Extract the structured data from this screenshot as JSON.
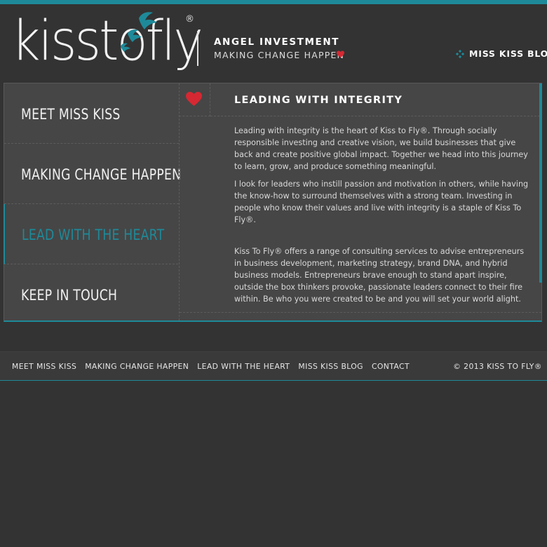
{
  "brand": {
    "logo_text": "kisstofly",
    "registered_mark": "®",
    "tagline_primary": "ANGEL INVESTMENT",
    "tagline_secondary": "MAKING CHANGE HAPPEN"
  },
  "header": {
    "blog_link": "MISS KISS BLOG",
    "blog_icon": "teal-diamond-cross-icon"
  },
  "sidebar": {
    "items": [
      {
        "label": "MEET MISS KISS",
        "active": false
      },
      {
        "label": "MAKING CHANGE HAPPEN",
        "active": false
      },
      {
        "label": "LEAD WITH THE HEART",
        "active": true
      },
      {
        "label": "KEEP IN TOUCH",
        "active": false
      }
    ]
  },
  "article": {
    "title": "LEADING WITH INTEGRITY",
    "paragraphs": [
      "Leading with integrity is the heart of Kiss to Fly®. Through socially responsible investing and creative vision, we build businesses that give back and create positive global impact. Together we head into this journey to learn, grow, and produce something meaningful.",
      "I look for leaders who instill passion and motivation in others, while having the know-how to surround themselves with a strong team. Investing in people who know their values and live with integrity is a staple of Kiss To Fly®.",
      "Kiss To Fly® offers a range of consulting services to advise entrepreneurs in business development, marketing strategy, brand DNA, and hybrid business models. Entrepreneurs brave enough to stand apart inspire, outside the box thinkers provoke, passionate leaders connect to their fire within. Be who you were created to be and you will set your world alight."
    ]
  },
  "footer": {
    "nav": [
      "MEET MISS KISS",
      "MAKING CHANGE HAPPEN",
      "LEAD WITH THE HEART",
      "MISS KISS BLOG",
      "CONTACT"
    ],
    "copyright": "© 2013 KISS TO FLY®"
  },
  "colors": {
    "accent": "#1e8a99",
    "heart": "#d62832",
    "background": "#333333",
    "panel": "#464646"
  }
}
